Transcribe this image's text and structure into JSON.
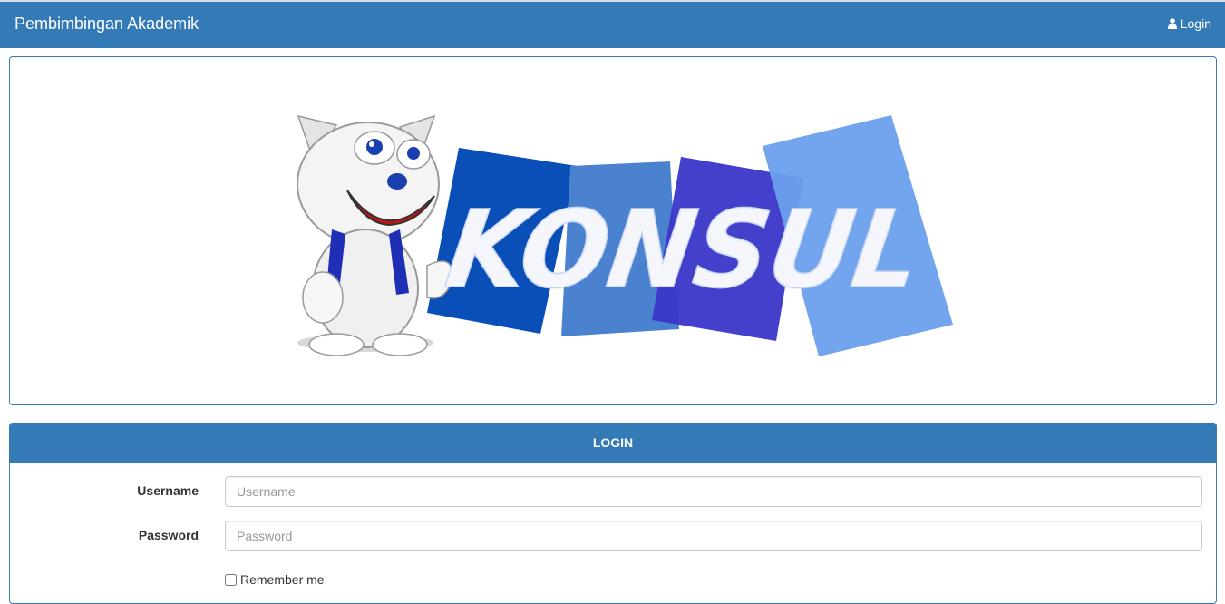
{
  "navbar": {
    "brand": "Pembimbingan Akademik",
    "login_label": "Login",
    "login_icon": "user-icon",
    "bg_color": "#337ab7"
  },
  "banner": {
    "logo_text": "KONSUL",
    "mascot": "cat-mascot"
  },
  "login_panel": {
    "heading": "LOGIN",
    "username_label": "Username",
    "username_placeholder": "Username",
    "username_value": "",
    "password_label": "Password",
    "password_placeholder": "Password",
    "password_value": "",
    "remember_label": "Remember me",
    "remember_checked": false
  }
}
